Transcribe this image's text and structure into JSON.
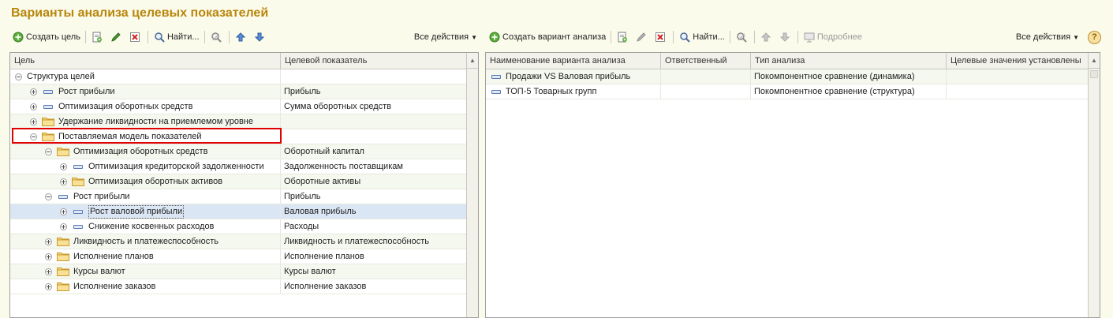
{
  "page": {
    "title": "Варианты анализа целевых показателей"
  },
  "colors": {
    "title": "#b8860b",
    "highlight": "#e00000",
    "selection": "#dbe6f4"
  },
  "left_toolbar": {
    "create_label": "Создать цель",
    "find_label": "Найти...",
    "all_actions_label": "Все действия"
  },
  "right_toolbar": {
    "create_label": "Создать вариант анализа",
    "find_label": "Найти...",
    "details_label": "Подробнее",
    "all_actions_label": "Все действия",
    "help_label": "?"
  },
  "goals_table": {
    "columns": [
      "Цель",
      "Целевой показатель"
    ],
    "rows": [
      {
        "name": "Структура целей",
        "indicator": "",
        "level": 0,
        "kind": "root",
        "expanded": true
      },
      {
        "name": "Рост прибыли",
        "indicator": "Прибыль",
        "level": 1,
        "kind": "item",
        "expanded": false
      },
      {
        "name": "Оптимизация оборотных средств",
        "indicator": "Сумма оборотных средств",
        "level": 1,
        "kind": "item",
        "expanded": false
      },
      {
        "name": "Удержание ликвидности на приемлемом уровне",
        "indicator": "",
        "level": 1,
        "kind": "folder",
        "expanded": false
      },
      {
        "name": "Поставляемая модель показателей",
        "indicator": "",
        "level": 1,
        "kind": "folder",
        "expanded": true,
        "highlighted": true
      },
      {
        "name": "Оптимизация оборотных средств",
        "indicator": "Оборотный капитал",
        "level": 2,
        "kind": "folder",
        "expanded": true
      },
      {
        "name": "Оптимизация кредиторской задолженности",
        "indicator": "Задолженность поставщикам",
        "level": 3,
        "kind": "item",
        "expanded": false
      },
      {
        "name": "Оптимизация оборотных активов",
        "indicator": "Оборотные активы",
        "level": 3,
        "kind": "folder",
        "expanded": false
      },
      {
        "name": "Рост прибыли",
        "indicator": "Прибыль",
        "level": 2,
        "kind": "item",
        "expanded": true
      },
      {
        "name": "Рост валовой прибыли",
        "indicator": "Валовая прибыль",
        "level": 3,
        "kind": "item",
        "expanded": false,
        "selected": true
      },
      {
        "name": "Снижение косвенных расходов",
        "indicator": "Расходы",
        "level": 3,
        "kind": "item",
        "expanded": false
      },
      {
        "name": "Ликвидность и платежеспособность",
        "indicator": "Ликвидность и платежеспособность",
        "level": 2,
        "kind": "folder",
        "expanded": false
      },
      {
        "name": "Исполнение планов",
        "indicator": "Исполнение планов",
        "level": 2,
        "kind": "folder",
        "expanded": false
      },
      {
        "name": "Курсы валют",
        "indicator": "Курсы валют",
        "level": 2,
        "kind": "folder",
        "expanded": false
      },
      {
        "name": "Исполнение заказов",
        "indicator": "Исполнение заказов",
        "level": 2,
        "kind": "folder",
        "expanded": false
      }
    ]
  },
  "variants_table": {
    "columns": [
      "Наименование варианта анализа",
      "Ответственный",
      "Тип анализа",
      "Целевые значения установлены"
    ],
    "rows": [
      {
        "name": "Продажи VS Валовая прибыль",
        "responsible": "",
        "type": "Покомпонентное сравнение (динамика)",
        "targets_set": ""
      },
      {
        "name": "ТОП-5 Товарных групп",
        "responsible": "",
        "type": "Покомпонентное сравнение (структура)",
        "targets_set": ""
      }
    ]
  }
}
